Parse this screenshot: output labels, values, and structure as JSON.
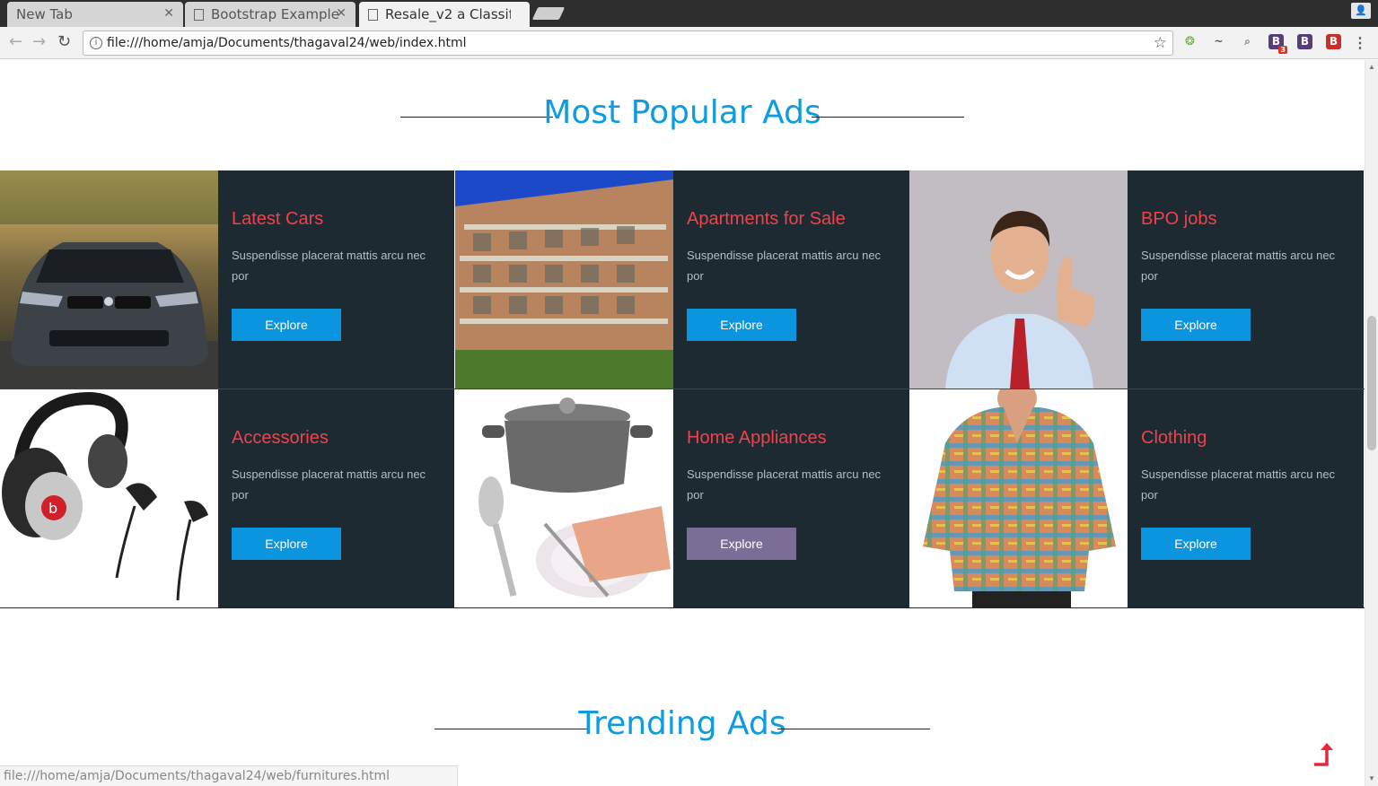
{
  "browser": {
    "tabs": [
      {
        "title": "New Tab"
      },
      {
        "title": "Bootstrap Example"
      },
      {
        "title": "Resale_v2 a Classifi"
      }
    ],
    "url": "file:///home/amja/Documents/thagaval24/web/index.html",
    "status_url": "file:///home/amja/Documents/thagaval24/web/furnitures.html",
    "extension_badge": "3"
  },
  "popular": {
    "title": "Most Popular Ads",
    "cards": [
      {
        "title": "Latest Cars",
        "desc": "Suspendisse placerat mattis arcu nec por",
        "button": "Explore",
        "image": "car-image"
      },
      {
        "title": "Apartments for Sale",
        "desc": "Suspendisse placerat mattis arcu nec por",
        "button": "Explore",
        "image": "apartment-image"
      },
      {
        "title": "BPO jobs",
        "desc": "Suspendisse placerat mattis arcu nec por",
        "button": "Explore",
        "image": "businessman-image"
      },
      {
        "title": "Accessories",
        "desc": "Suspendisse placerat mattis arcu nec por",
        "button": "Explore",
        "image": "headphones-image"
      },
      {
        "title": "Home Appliances",
        "desc": "Suspendisse placerat mattis arcu nec por",
        "button": "Explore",
        "image": "cookware-image"
      },
      {
        "title": "Clothing",
        "desc": "Suspendisse placerat mattis arcu nec por",
        "button": "Explore",
        "image": "shirt-image"
      }
    ]
  },
  "trending": {
    "title": "Trending Ads"
  },
  "colors": {
    "accent": "#0e9ce0",
    "card_bg": "#1e2a32",
    "card_title": "#f0424a",
    "button": "#0a95de",
    "button_hover": "#7a6e96"
  }
}
